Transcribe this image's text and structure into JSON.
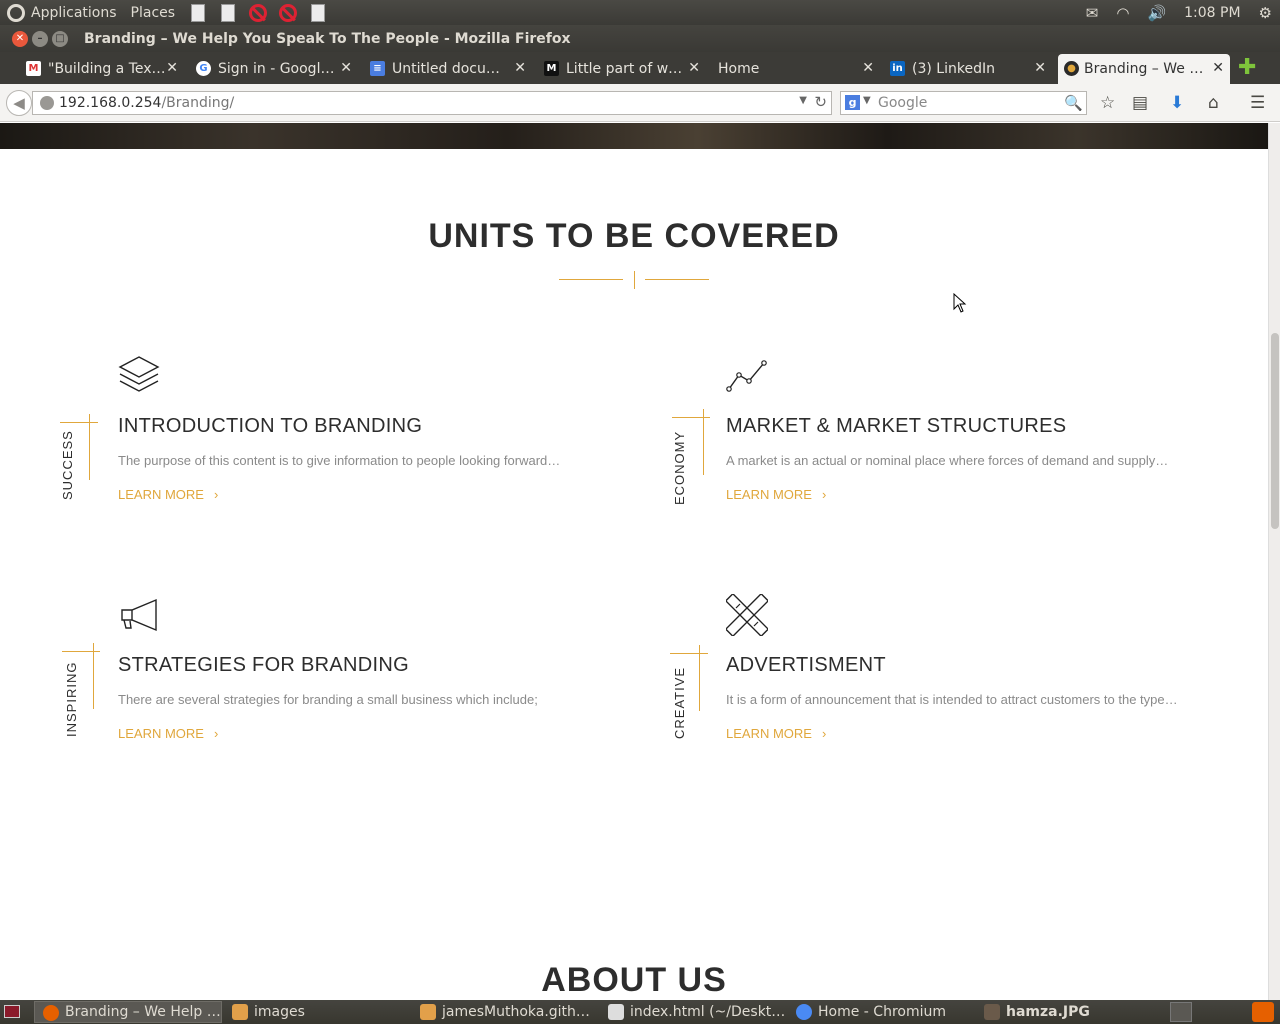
{
  "panel": {
    "menus": [
      "Applications",
      "Places"
    ],
    "clock": "1:08 PM"
  },
  "window": {
    "title": "Branding – We Help You Speak To The People - Mozilla Firefox"
  },
  "tabs": [
    {
      "label": "\"Building a Tex…",
      "favicon": "gmail-icon"
    },
    {
      "label": "Sign in - Googl…",
      "favicon": "google-icon"
    },
    {
      "label": "Untitled docu…",
      "favicon": "docs-icon"
    },
    {
      "label": "Little part of w…",
      "favicon": "medium-icon"
    },
    {
      "label": "Home",
      "favicon": ""
    },
    {
      "label": "(3) LinkedIn",
      "favicon": "linkedin-icon"
    },
    {
      "label": "Branding – We …",
      "favicon": "site-icon"
    }
  ],
  "navbar": {
    "url_host": "192.168.0.254",
    "url_path": "/Branding/",
    "search_placeholder": "Google"
  },
  "page": {
    "section_title": "UNITS TO BE COVERED",
    "units": [
      {
        "side_label": "SUCCESS",
        "title": "INTRODUCTION TO BRANDING",
        "desc": "The purpose of this content is to give information to people looking forward…",
        "link": "LEARN MORE",
        "icon": "layers-icon"
      },
      {
        "side_label": "ECONOMY",
        "title": "MARKET & MARKET STRUCTURES",
        "desc": "A market is an actual or nominal place where forces of demand and supply…",
        "link": "LEARN MORE",
        "icon": "line-chart-icon"
      },
      {
        "side_label": "INSPIRING",
        "title": "STRATEGIES FOR BRANDING",
        "desc": "There are several strategies for branding a small business which include;",
        "link": "LEARN MORE",
        "icon": "megaphone-icon"
      },
      {
        "side_label": "CREATIVE",
        "title": "ADVERTISMENT",
        "desc": "It is a form of  announcement that is intended to attract customers to the type…",
        "link": "LEARN MORE",
        "icon": "pencil-ruler-icon"
      }
    ],
    "next_section_title": "ABOUT US"
  },
  "taskbar": [
    {
      "label": "Branding – We Help …",
      "icon": "firefox-icon"
    },
    {
      "label": "images",
      "icon": "folder-icon"
    },
    {
      "label": "jamesMuthoka.gith…",
      "icon": "folder-icon"
    },
    {
      "label": "index.html (~/Deskt…",
      "icon": "text-editor-icon"
    },
    {
      "label": "Home - Chromium",
      "icon": "chromium-icon"
    },
    {
      "label": "hamza.JPG",
      "icon": "image-viewer-icon"
    }
  ],
  "colors": {
    "accent": "#e0a73c",
    "heading": "#2d2d2d",
    "muted_text": "#8a8a8a"
  }
}
